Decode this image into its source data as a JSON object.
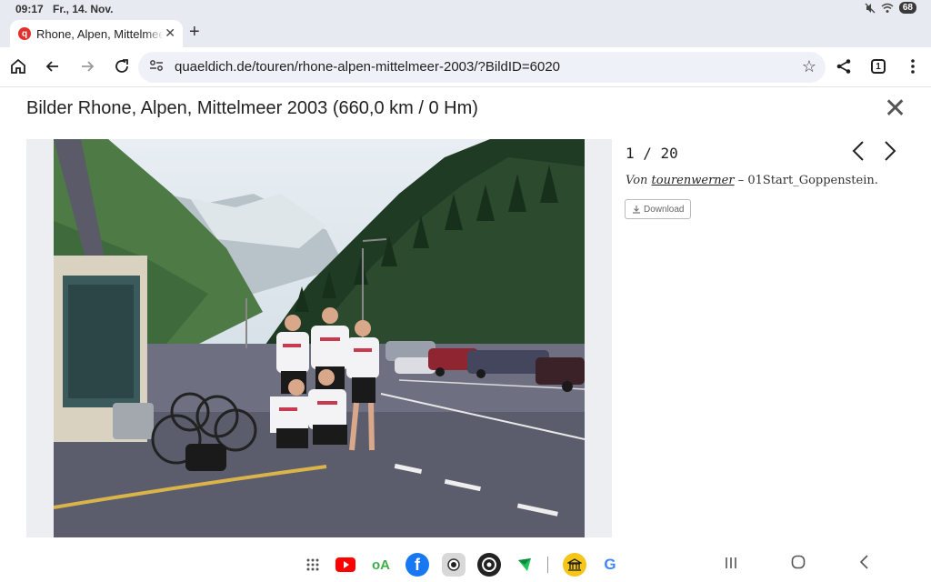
{
  "status": {
    "time": "09:17",
    "date": "Fr., 14. Nov.",
    "battery": "68"
  },
  "tab": {
    "title": "Rhone, Alpen, Mittelmeer",
    "close": "✕",
    "new_tab": "+"
  },
  "omnibox": {
    "url": "quaeldich.de/touren/rhone-alpen-mittelmeer-2003/?BildID=6020"
  },
  "toolbar": {
    "tab_count": "1"
  },
  "page": {
    "title": "Bilder Rhone, Alpen, Mittelmeer 2003 (660,0 km / 0 Hm)",
    "counter": "1 / 20",
    "caption_prefix": "Von",
    "author": "tourenwerner",
    "caption_suffix": " – 01Start_Goppenstein.",
    "download_label": "Download"
  },
  "icons": {
    "home": "home-icon",
    "back": "arrow-left-icon",
    "forward": "arrow-right-icon",
    "reload": "reload-icon",
    "site_settings": "site-settings-icon",
    "bookmark": "star-icon",
    "share": "share-icon",
    "menu": "more-vert-icon",
    "close": "close-icon",
    "prev": "chevron-left-icon",
    "next": "chevron-right-icon"
  },
  "dock": {
    "apps": [
      "app-grid",
      "youtube",
      "outdooractive",
      "facebook",
      "camera",
      "settings-wheel",
      "maps-arrow",
      "museum",
      "google"
    ]
  },
  "colors": {
    "accent_red": "#e0322b",
    "omnibox_bg": "#eef1f8",
    "chrome_bg": "#e8eaf1"
  }
}
